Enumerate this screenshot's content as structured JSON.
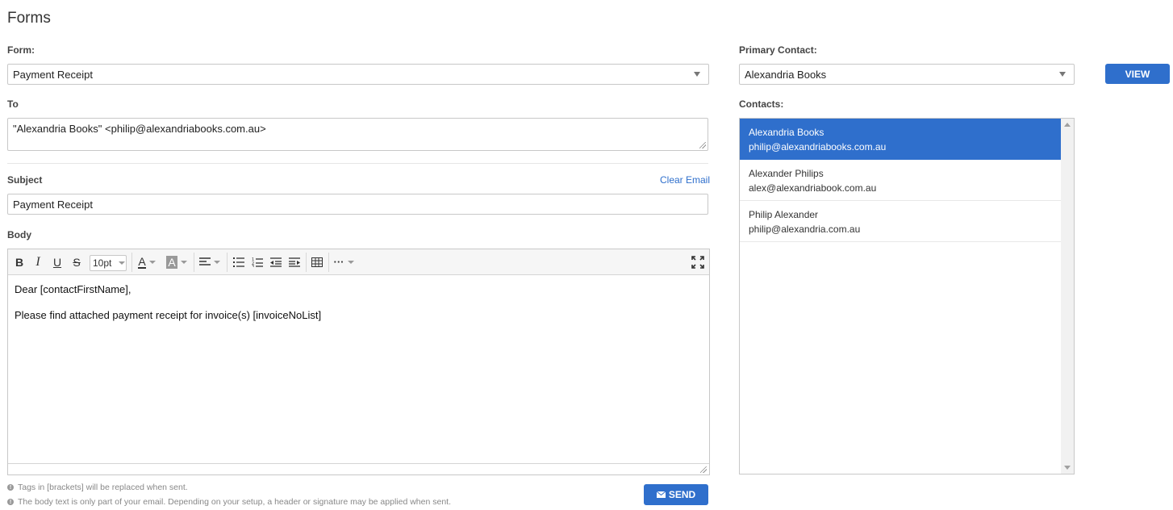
{
  "page": {
    "title": "Forms"
  },
  "form_field": {
    "label": "Form:",
    "value": "Payment Receipt"
  },
  "to_field": {
    "label": "To",
    "value": "\"Alexandria Books\" <philip@alexandriabooks.com.au>"
  },
  "subject_field": {
    "label": "Subject",
    "value": "Payment Receipt",
    "clear_link": "Clear Email"
  },
  "body": {
    "label": "Body",
    "font_size": "10pt",
    "lines": [
      "Dear [contactFirstName],",
      "Please find attached payment receipt for invoice(s) [invoiceNoList]"
    ]
  },
  "hints": [
    "Tags in [brackets] will be replaced when sent.",
    "The body text is only part of your email. Depending on your setup, a header or signature may be applied when sent."
  ],
  "send_button": {
    "label": "SEND"
  },
  "primary_contact": {
    "label": "Primary Contact:",
    "value": "Alexandria Books",
    "view_label": "VIEW"
  },
  "contacts": {
    "label": "Contacts:",
    "items": [
      {
        "name": "Alexandria Books",
        "email": "philip@alexandriabooks.com.au",
        "selected": true
      },
      {
        "name": "Alexander Philips",
        "email": "alex@alexandriabook.com.au",
        "selected": false
      },
      {
        "name": "Philip Alexander",
        "email": "philip@alexandria.com.au",
        "selected": false
      }
    ]
  },
  "colors": {
    "accent": "#2f6fcc"
  }
}
